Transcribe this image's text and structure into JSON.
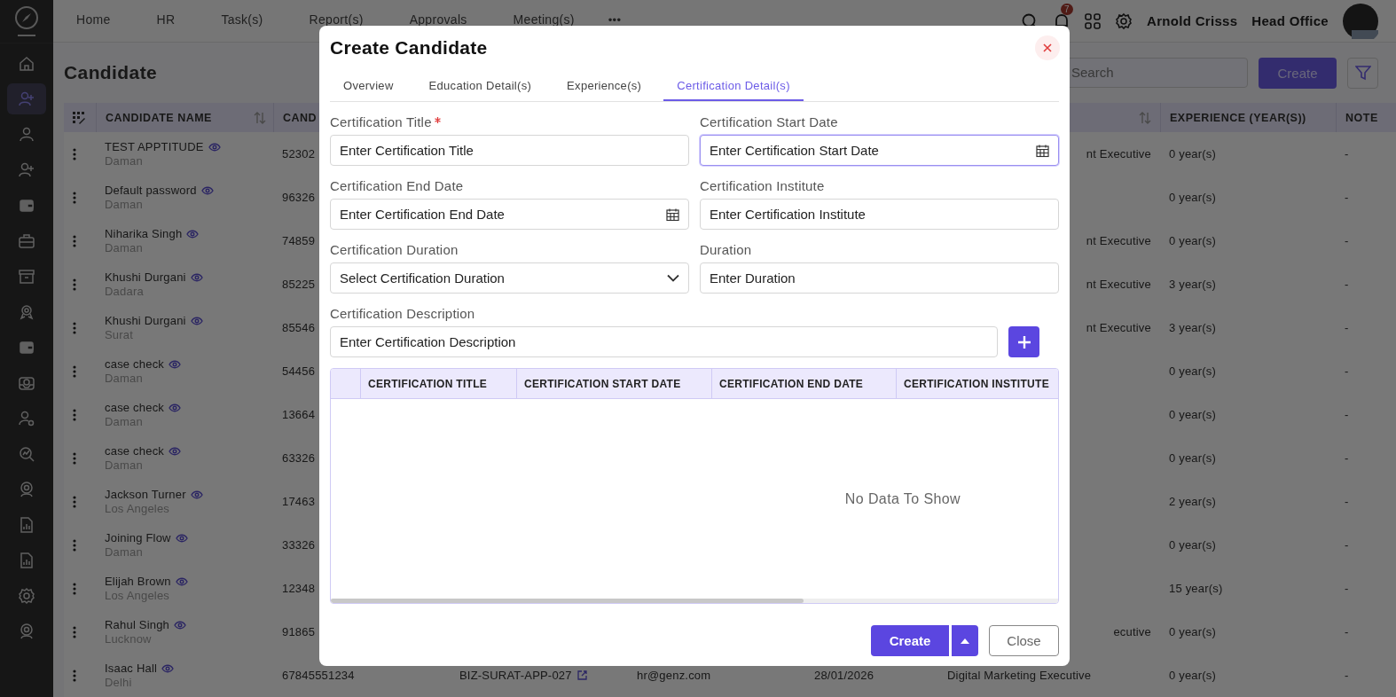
{
  "sidebar": {
    "items": [
      {
        "kind": "home",
        "selected": false
      },
      {
        "kind": "user-plus",
        "selected": true
      },
      {
        "kind": "user",
        "selected": false
      },
      {
        "kind": "user-plus",
        "selected": false
      },
      {
        "kind": "wallet",
        "selected": false
      },
      {
        "kind": "briefcase",
        "selected": false
      },
      {
        "kind": "archive",
        "selected": false
      },
      {
        "kind": "badge",
        "selected": false
      },
      {
        "kind": "wallet",
        "selected": false
      },
      {
        "kind": "inbox",
        "selected": false
      },
      {
        "kind": "user-gear",
        "selected": false
      },
      {
        "kind": "search-chart",
        "selected": false
      },
      {
        "kind": "user-ring",
        "selected": false
      },
      {
        "kind": "report",
        "selected": false
      },
      {
        "kind": "report",
        "selected": false
      },
      {
        "kind": "gear",
        "selected": false
      },
      {
        "kind": "user-ring",
        "selected": false
      }
    ]
  },
  "nav": {
    "items": [
      "Home",
      "HR",
      "Task(s)",
      "Report(s)",
      "Approvals",
      "Meeting(s)"
    ],
    "more": "•••"
  },
  "header": {
    "notifications": "7",
    "user": "Arnold Crisss",
    "branch": "Head Office"
  },
  "page": {
    "title": "Candidate",
    "search_placeholder": "Search",
    "create": "Create"
  },
  "table": {
    "columns": {
      "name": "CANDIDATE NAME",
      "phone": "CAND",
      "experience": "EXPERIENCE (YEAR(S))",
      "notes": "NOTE"
    },
    "rows": [
      {
        "name": "TEST APPTITUDE",
        "city": "Daman",
        "phone": "52302",
        "designation": "nt Executive",
        "experience": "0 year(s)",
        "note": "-"
      },
      {
        "name": "Default password",
        "city": "Daman",
        "phone": "96326",
        "experience": "0 year(s)",
        "note": "-"
      },
      {
        "name": "Niharika Singh",
        "city": "Daman",
        "phone": "74859",
        "designation": "nt Executive",
        "experience": "0 year(s)",
        "note": "-"
      },
      {
        "name": "Khushi Durgani",
        "city": "Dadara",
        "phone": "85225",
        "designation": "nt Executive",
        "experience": "3 year(s)",
        "note": "-"
      },
      {
        "name": "Khushi Durgani",
        "city": "Surat",
        "phone": "85546",
        "designation": "nt Executive",
        "experience": "3 year(s)",
        "note": "-"
      },
      {
        "name": "case check",
        "city": "Daman",
        "phone": "54456",
        "experience": "0 year(s)",
        "note": "-"
      },
      {
        "name": "case check",
        "city": "Daman",
        "phone": "13664",
        "experience": "0 year(s)",
        "note": "-"
      },
      {
        "name": "case check",
        "city": "Daman",
        "phone": "63326",
        "experience": "0 year(s)",
        "note": "-"
      },
      {
        "name": "Jackson Turner",
        "city": "Los Angeles",
        "phone": "17463",
        "experience": "2 year(s)",
        "note": "-"
      },
      {
        "name": "Joining Flow",
        "city": "Daman",
        "phone": "33326",
        "experience": "0 year(s)",
        "note": "-"
      },
      {
        "name": "Elijah Brown",
        "city": "Los Angeles",
        "phone": "12348",
        "experience": "15 year(s)",
        "note": "-"
      },
      {
        "name": "Rahul Singh",
        "city": "Lucknow",
        "phone": "91865",
        "designation": "ecutive",
        "experience": "0 year(s)",
        "note": "-"
      },
      {
        "name": "Isaac Hall",
        "city": "Delhi",
        "phone": "67845551234",
        "application": "BIZ-SURAT-APP-027",
        "email": "hr@genz.com",
        "date": "28/01/2026",
        "designation": "Digital Marketing Executive",
        "experience": "0 year(s)",
        "note": "-"
      }
    ]
  },
  "modal": {
    "title": "Create Candidate",
    "tabs": [
      {
        "label": "Overview",
        "selected": false
      },
      {
        "label": "Education Detail(s)",
        "selected": false
      },
      {
        "label": "Experience(s)",
        "selected": false
      },
      {
        "label": "Certification Detail(s)",
        "selected": true
      }
    ],
    "fields": [
      {
        "label": "Certification Title",
        "required": true,
        "kind": "text",
        "placeholder": "Enter Certification Title",
        "focused": false
      },
      {
        "label": "Certification Start Date",
        "required": false,
        "kind": "date",
        "placeholder": "Enter Certification Start Date",
        "focused": true
      },
      {
        "label": "Certification End Date",
        "required": false,
        "kind": "date",
        "placeholder": "Enter Certification End Date",
        "focused": false
      },
      {
        "label": "Certification Institute",
        "required": false,
        "kind": "text",
        "placeholder": "Enter Certification Institute",
        "focused": false
      },
      {
        "label": "Certification Duration",
        "required": false,
        "kind": "select",
        "placeholder": "Select Certification Duration",
        "focused": false
      },
      {
        "label": "Duration",
        "required": false,
        "kind": "text",
        "placeholder": "Enter Duration",
        "focused": false
      }
    ],
    "description": {
      "label": "Certification Description",
      "placeholder": "Enter Certification Description"
    },
    "table": {
      "columns": [
        "CERTIFICATION TITLE",
        "CERTIFICATION START DATE",
        "CERTIFICATION END DATE",
        "CERTIFICATION INSTITUTE"
      ],
      "empty": "No Data To Show"
    },
    "buttons": {
      "create": "Create",
      "close": "Close"
    }
  }
}
